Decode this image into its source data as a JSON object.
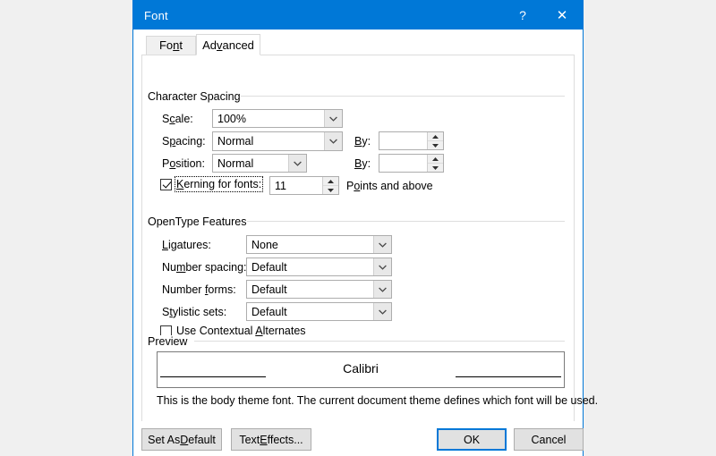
{
  "dialog": {
    "title": "Font",
    "help_button": "?",
    "close_button": "✕"
  },
  "tabs": [
    {
      "label": "Font",
      "accel": "n",
      "active": false
    },
    {
      "label": "Advanced",
      "accel": "v",
      "active": true
    }
  ],
  "character_spacing": {
    "group_label": "Character Spacing",
    "scale": {
      "label": "Scale:",
      "accel": "c",
      "value": "100%"
    },
    "spacing": {
      "label": "Spacing:",
      "accel": "p",
      "value": "Normal",
      "by_label": "By:",
      "by_accel": "y",
      "by_value": ""
    },
    "position": {
      "label": "Position:",
      "accel": "o",
      "value": "Normal",
      "by_label": "By:",
      "by_accel": "y",
      "by_value": ""
    },
    "kerning": {
      "label": "Kerning for fonts:",
      "accel": "K",
      "checked": true,
      "value": "11",
      "suffix": "Points and above",
      "suffix_accel": "o"
    }
  },
  "opentype_features": {
    "group_label": "OpenType Features",
    "ligatures": {
      "label": "Ligatures:",
      "accel": "L",
      "value": "None"
    },
    "number_spacing": {
      "label": "Number spacing:",
      "accel": "m",
      "value": "Default"
    },
    "number_forms": {
      "label": "Number forms:",
      "accel": "f",
      "value": "Default"
    },
    "stylistic_sets": {
      "label": "Stylistic sets:",
      "accel": "t",
      "value": "Default"
    },
    "contextual_alternates": {
      "label": "Use Contextual Alternates",
      "accel": "A",
      "checked": false
    }
  },
  "preview": {
    "group_label": "Preview",
    "sample_text": "Calibri",
    "note": "This is the body theme font. The current document theme defines which font will be used."
  },
  "footer": {
    "set_as_default": "Set As Default",
    "set_as_default_accel": "D",
    "text_effects": "Text Effects...",
    "text_effects_accel": "E",
    "ok": "OK",
    "cancel": "Cancel"
  },
  "colors": {
    "titlebar": "#0078d7",
    "accent": "#0078d7",
    "dialog_bg": "#ffffff",
    "desktop_bg": "#f0f0f0",
    "button_face": "#e1e1e1"
  }
}
